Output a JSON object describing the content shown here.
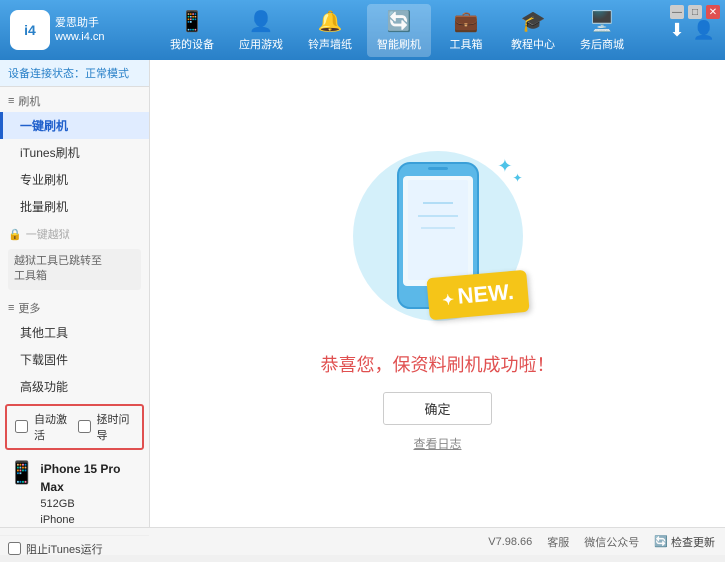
{
  "logo": {
    "icon_text": "i4",
    "line1": "爱思助手",
    "line2": "www.i4.cn"
  },
  "nav": {
    "items": [
      {
        "id": "my-device",
        "label": "我的设备",
        "icon": "📱"
      },
      {
        "id": "app-game",
        "label": "应用游戏",
        "icon": "👤"
      },
      {
        "id": "ringtone",
        "label": "铃声墙纸",
        "icon": "🔔"
      },
      {
        "id": "smart-flash",
        "label": "智能刷机",
        "icon": "🔄",
        "active": true
      },
      {
        "id": "toolbox",
        "label": "工具箱",
        "icon": "💼"
      },
      {
        "id": "tutorial",
        "label": "教程中心",
        "icon": "🎓"
      },
      {
        "id": "service",
        "label": "务后商城",
        "icon": "🖥️"
      }
    ],
    "download_icon": "⬇",
    "user_icon": "👤"
  },
  "sidebar": {
    "status_label": "设备连接状态：",
    "status_value": "正常模式",
    "sections": [
      {
        "label": "刷机",
        "icon": "≡",
        "items": [
          {
            "id": "one-key-flash",
            "label": "一键刷机",
            "active": true
          },
          {
            "id": "itunes-flash",
            "label": "iTunes刷机"
          },
          {
            "id": "pro-flash",
            "label": "专业刷机"
          },
          {
            "id": "batch-flash",
            "label": "批量刷机"
          }
        ]
      },
      {
        "label": "一键越狱",
        "icon": "🔒",
        "disabled": true,
        "note": "越狱工具已跳转至\n工具箱"
      },
      {
        "label": "更多",
        "icon": "≡",
        "items": [
          {
            "id": "other-tools",
            "label": "其他工具"
          },
          {
            "id": "download-fw",
            "label": "下载固件"
          },
          {
            "id": "advanced",
            "label": "高级功能"
          }
        ]
      }
    ],
    "checkbox_row": {
      "auto_activate": {
        "label": "自动激活",
        "checked": false
      },
      "backup_data": {
        "label": "拯时问导",
        "checked": false
      }
    },
    "device": {
      "icon": "📱",
      "name": "iPhone 15 Pro Max",
      "storage": "512GB",
      "type": "iPhone"
    },
    "block_itunes": {
      "label": "阻止iTunes运行",
      "checked": false
    }
  },
  "content": {
    "success_title": "恭喜您，保资料刷机成功啦！",
    "confirm_button": "确定",
    "view_log": "查看日志"
  },
  "footer": {
    "version": "V7.98.66",
    "links": [
      "客服",
      "微信公众号",
      "检查更新"
    ]
  },
  "window_controls": [
    "—",
    "□",
    "✕"
  ]
}
